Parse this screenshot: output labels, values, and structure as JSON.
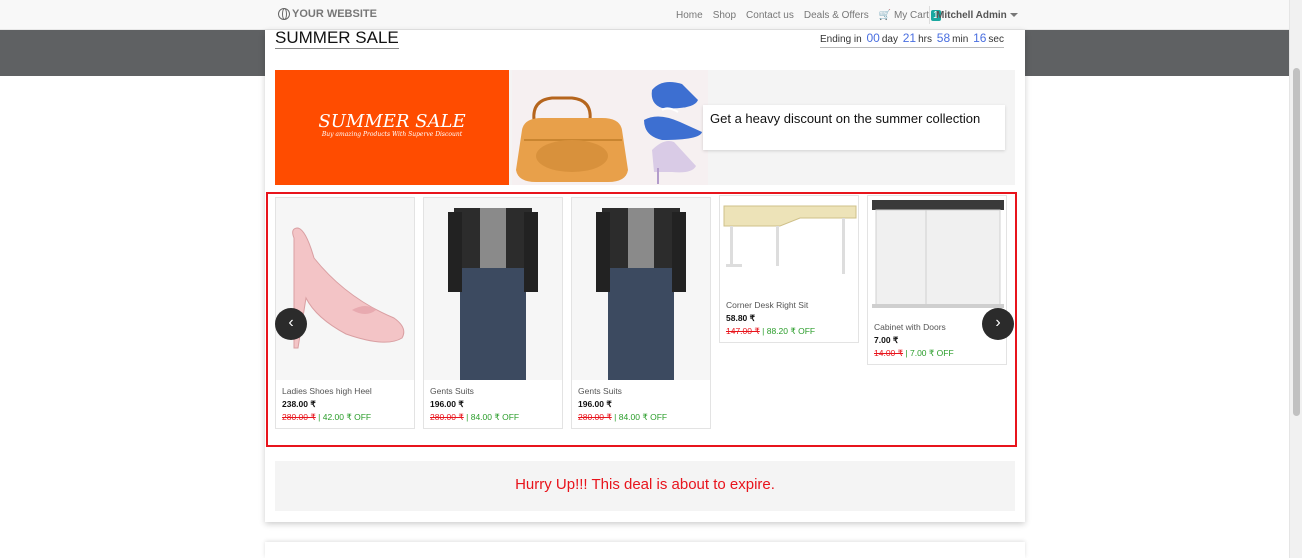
{
  "navbar": {
    "logo_text": "YOUR WEBSITE",
    "links": [
      "Home",
      "Shop",
      "Contact us",
      "Deals & Offers"
    ],
    "cart_label": "My Cart",
    "cart_count": "1",
    "user_name": "Mitchell Admin"
  },
  "sale": {
    "title": "SUMMER SALE",
    "countdown": {
      "prefix": "Ending in",
      "days": "00",
      "days_label": "day",
      "hours": "21",
      "hours_label": "hrs",
      "minutes": "58",
      "minutes_label": "min",
      "seconds": "16",
      "seconds_label": "sec"
    },
    "banner": {
      "headline": "SUMMER SALE",
      "tagline": "Buy amazing Products With Superve Discount",
      "caption": "Get a heavy discount on the summer collection"
    },
    "products": [
      {
        "name": "Ladies Shoes high Heel",
        "price": "238.00 ₹",
        "old_price": "280.00 ₹",
        "discount": "| 42.00 ₹ OFF"
      },
      {
        "name": "Gents Suits",
        "price": "196.00 ₹",
        "old_price": "280.00 ₹",
        "discount": "| 84.00 ₹ OFF"
      },
      {
        "name": "Gents Suits",
        "price": "196.00 ₹",
        "old_price": "280.00 ₹",
        "discount": "| 84.00 ₹ OFF"
      },
      {
        "name": "Corner Desk Right Sit",
        "price": "58.80 ₹",
        "old_price": "147.00 ₹",
        "discount": "| 88.20 ₹ OFF"
      },
      {
        "name": "Cabinet with Doors",
        "price": "7.00 ₹",
        "old_price": "14.00 ₹",
        "discount": "| 7.00 ₹ OFF"
      }
    ],
    "prev_arrow": "‹",
    "next_arrow": "›",
    "deal_message": "Hurry Up!!! This deal is about to expire."
  },
  "colors": {
    "accent_red": "#e8141c",
    "banner_orange": "#ff4c00",
    "countdown_blue": "#4a6fe0",
    "discount_green": "#2a9d2a"
  }
}
